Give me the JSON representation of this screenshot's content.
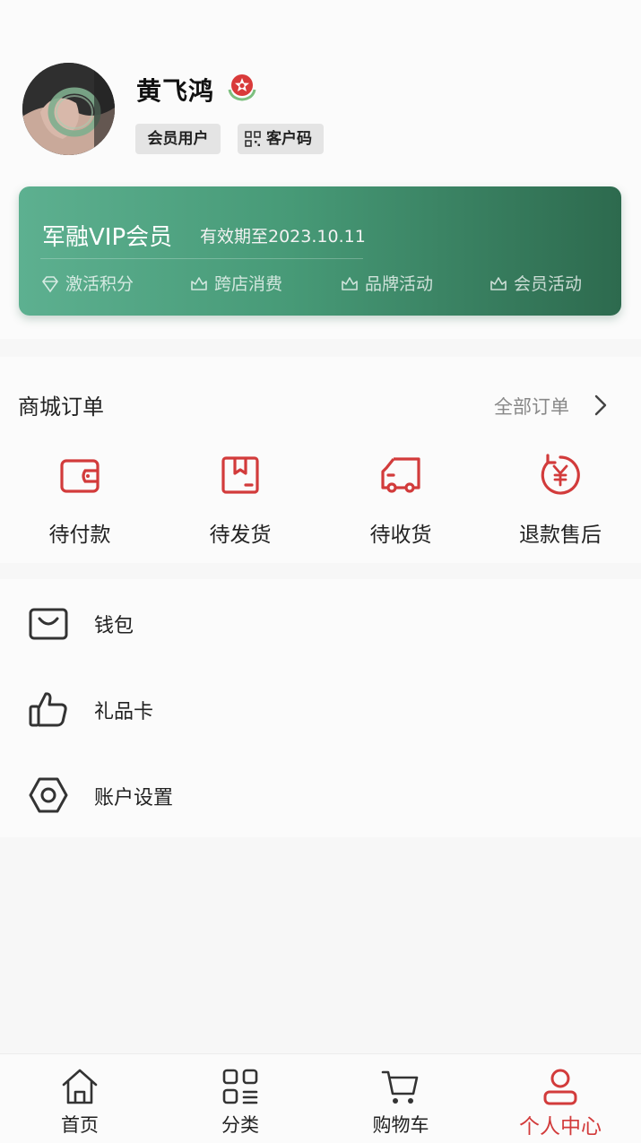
{
  "profile": {
    "name": "黄飞鸿",
    "tags": {
      "member": "会员用户",
      "code": "客户码"
    }
  },
  "vip": {
    "title": "军融VIP会员",
    "expiry": "有效期至2023.10.11",
    "perks": [
      "激活积分",
      "跨店消费",
      "品牌活动",
      "会员活动"
    ]
  },
  "orders": {
    "title": "商城订单",
    "all_label": "全部订单",
    "items": [
      {
        "label": "待付款",
        "icon": "wallet-icon"
      },
      {
        "label": "待发货",
        "icon": "package-icon"
      },
      {
        "label": "待收货",
        "icon": "truck-icon"
      },
      {
        "label": "退款售后",
        "icon": "refund-icon"
      }
    ]
  },
  "menu": {
    "items": [
      {
        "label": "钱包",
        "icon": "bag-icon"
      },
      {
        "label": "礼品卡",
        "icon": "thumbs-up-icon"
      },
      {
        "label": "账户设置",
        "icon": "hexagon-settings-icon"
      }
    ]
  },
  "tabbar": {
    "items": [
      {
        "label": "首页",
        "icon": "home-icon"
      },
      {
        "label": "分类",
        "icon": "grid-icon"
      },
      {
        "label": "购物车",
        "icon": "cart-icon"
      },
      {
        "label": "个人中心",
        "icon": "user-icon"
      }
    ],
    "active_index": 3
  },
  "colors": {
    "accent": "#d23b3b",
    "vip_start": "#5db090",
    "vip_end": "#2d6a4e"
  }
}
